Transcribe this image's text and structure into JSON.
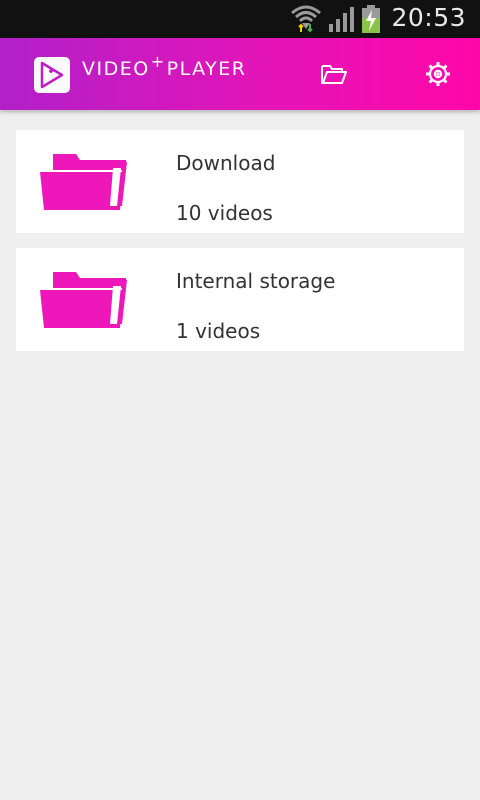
{
  "status_bar": {
    "time": "20:53"
  },
  "app_bar": {
    "title_part1": "VIDEO",
    "title_plus": "+",
    "title_part2": "PLAYER",
    "accent_color": "#ff07a8",
    "actions": [
      {
        "icon": "folder-open-icon"
      },
      {
        "icon": "gear-icon"
      }
    ]
  },
  "folders": [
    {
      "name": "Download",
      "count": "10 videos",
      "icon": "folder-icon"
    },
    {
      "name": "Internal storage",
      "count": "1 videos",
      "icon": "folder-icon"
    }
  ],
  "colors": {
    "folder": "#ee18ba",
    "background": "#efefef",
    "card": "#ffffff"
  }
}
